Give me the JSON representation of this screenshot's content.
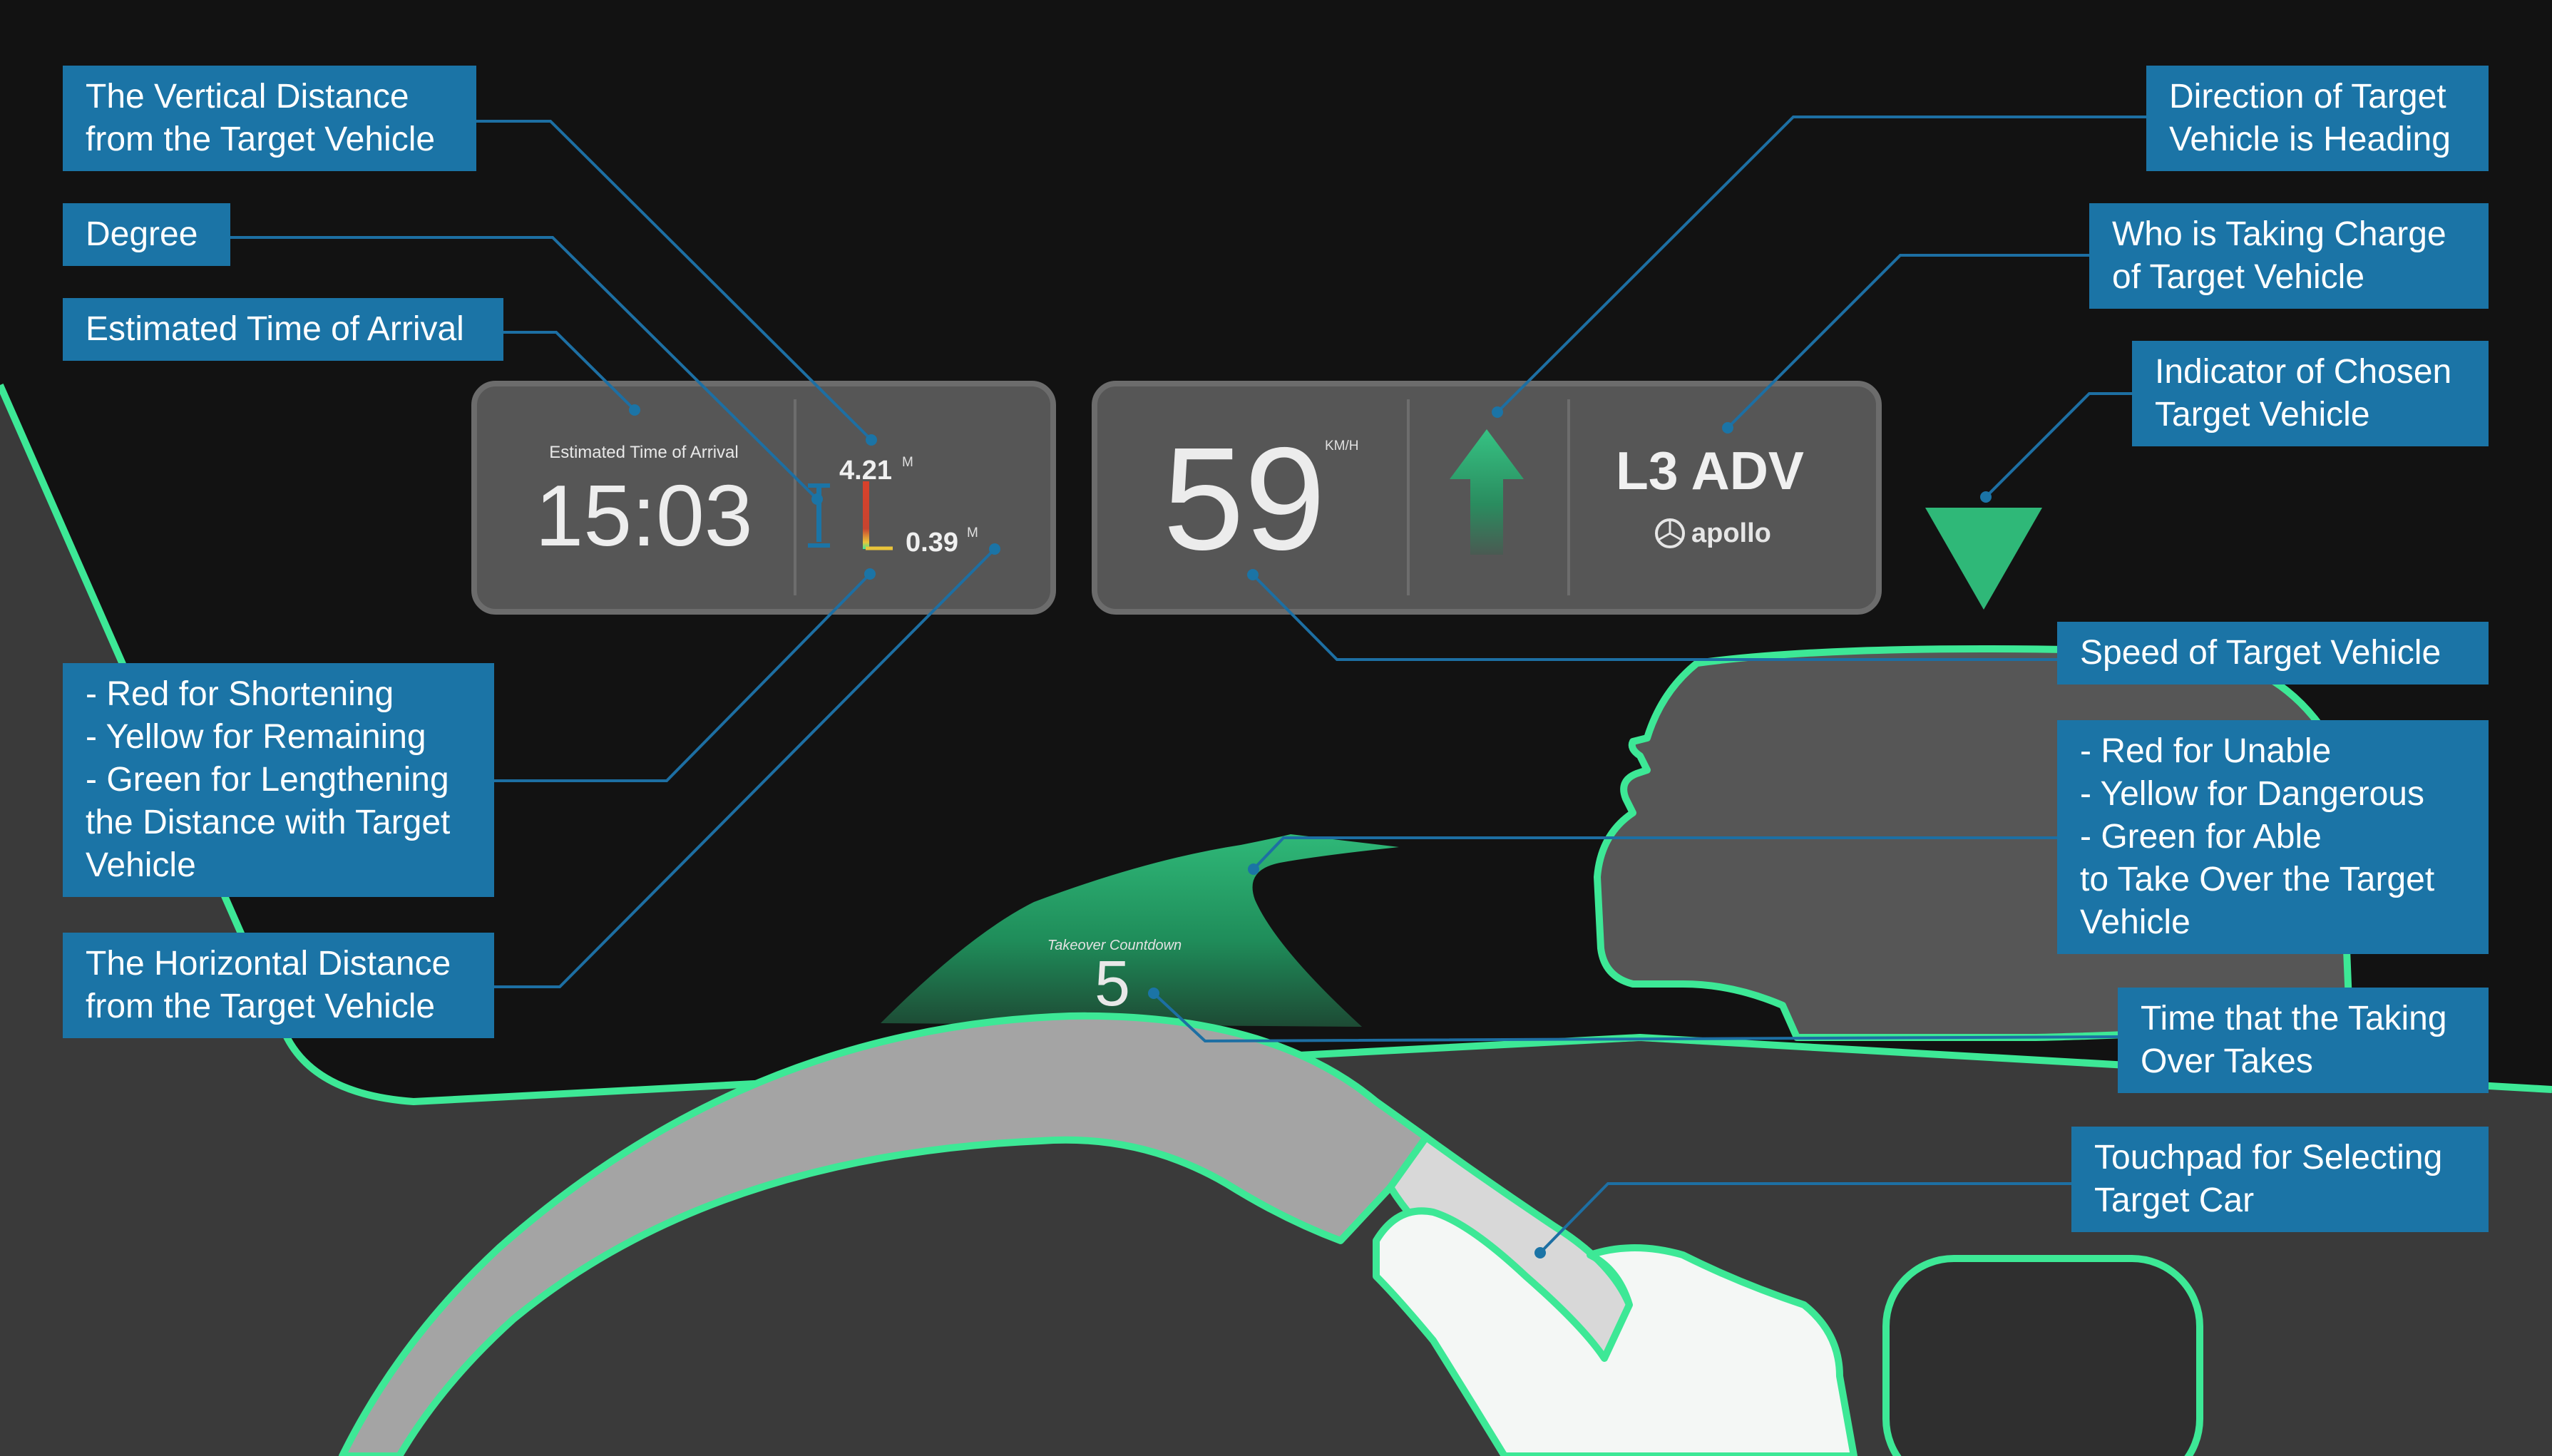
{
  "hud": {
    "eta_caption": "Estimated Time of Arrival",
    "eta_time": "15:03",
    "vertical_distance": "4.21",
    "vertical_unit": "M",
    "horizontal_distance": "0.39",
    "horizontal_unit": "M",
    "speed": "59",
    "speed_unit": "KM/H",
    "autonomy_level": "L3 ADV",
    "brand": "apollo",
    "takeover_caption": "Takeover Countdown",
    "takeover_count": "5"
  },
  "labels": {
    "vertical_distance": [
      "The Vertical Distance",
      "from the Target Vehicle"
    ],
    "degree": [
      "Degree"
    ],
    "eta": [
      "Estimated Time of Arrival"
    ],
    "distance_colors": [
      "- Red for Shortening",
      "- Yellow for Remaining",
      "- Green for Lengthening",
      "the Distance with Target",
      "Vehicle"
    ],
    "horizontal_distance": [
      "The Horizontal Distance",
      "from the Target Vehicle"
    ],
    "direction": [
      "Direction of Target",
      "Vehicle is Heading"
    ],
    "who_in_charge": [
      "Who is Taking Charge",
      "of Target Vehicle"
    ],
    "indicator": [
      "Indicator of Chosen",
      "Target Vehicle"
    ],
    "speed": [
      "Speed of Target Vehicle"
    ],
    "takeover_colors": [
      "- Red for Unable",
      "- Yellow for Dangerous",
      "- Green for Able",
      "to Take Over the Target",
      "Vehicle"
    ],
    "takeover_time": [
      "Time that the Taking",
      "Over Takes"
    ],
    "touchpad": [
      "Touchpad for Selecting",
      "Target Car"
    ]
  },
  "colors": {
    "background": "#121212",
    "interior": "#3a3a3a",
    "outline": "#3de896",
    "label_bg": "#1b74a6",
    "leader_line": "#1d6fa3",
    "hud_panel": "#565656",
    "indicator": "#2fb878",
    "distance_red": "#d9412b",
    "distance_yellow": "#e9c43a",
    "distance_green": "#3de896"
  }
}
